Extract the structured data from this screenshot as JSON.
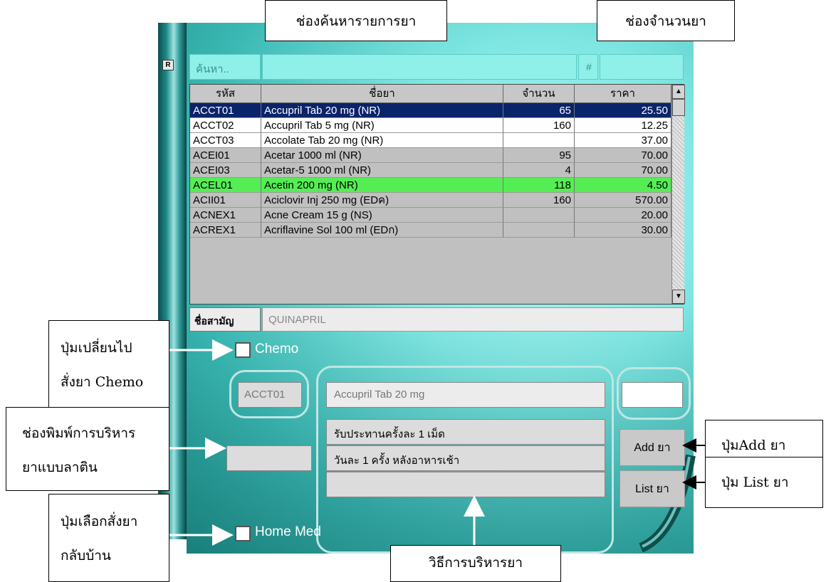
{
  "panel": {
    "corner_icon": "R",
    "search": {
      "label": "ค้นหา..",
      "value": ""
    },
    "qty": {
      "label": "#",
      "value": ""
    }
  },
  "grid": {
    "headers": [
      "รหัส",
      "ชื่อยา",
      "จำนวน",
      "ราคา"
    ],
    "rows": [
      {
        "code": "ACCT01",
        "name": "Accupril Tab 20 mg  (NR)",
        "qty": "65",
        "price": "25.50",
        "state": "selected"
      },
      {
        "code": "ACCT02",
        "name": "Accupril Tab 5 mg  (NR)",
        "qty": "160",
        "price": "12.25",
        "state": "white"
      },
      {
        "code": "ACCT03",
        "name": "Accolate Tab 20 mg  (NR)",
        "qty": "",
        "price": "37.00",
        "state": "white"
      },
      {
        "code": "ACEI01",
        "name": "Acetar 1000 ml  (NR)",
        "qty": "95",
        "price": "70.00",
        "state": "grey"
      },
      {
        "code": "ACEI03",
        "name": "Acetar-5 1000 ml  (NR)",
        "qty": "4",
        "price": "70.00",
        "state": "grey"
      },
      {
        "code": "ACEL01",
        "name": "Acetin 200 mg  (NR)",
        "qty": "118",
        "price": "4.50",
        "state": "green"
      },
      {
        "code": "ACII01",
        "name": "Aciclovir Inj 250 mg  (EDค)",
        "qty": "160",
        "price": "570.00",
        "state": "grey"
      },
      {
        "code": "ACNEX1",
        "name": "Acne Cream 15 g  (NS)",
        "qty": "",
        "price": "20.00",
        "state": "grey"
      },
      {
        "code": "ACREX1",
        "name": "Acriflavine Sol 100 ml  (EDก)",
        "qty": "",
        "price": "30.00",
        "state": "grey"
      }
    ]
  },
  "generic": {
    "label": "ชื่อสามัญ",
    "value": "QUINAPRIL"
  },
  "chemo": {
    "label": "Chemo"
  },
  "order": {
    "code": "ACCT01",
    "name": "Accupril Tab 20 mg",
    "qty": "",
    "latin": "",
    "instructions": [
      "รับประทานครั้งละ 1 เม็ด",
      "วันละ 1 ครั้ง หลังอาหารเช้า",
      ""
    ],
    "add_button": "Add ยา",
    "list_button": "List ยา"
  },
  "home_med": {
    "label": "Home Med"
  },
  "callouts": {
    "search_field": "ช่องค้นหารายการยา",
    "qty_field": "ช่องจำนวนยา",
    "chemo_toggle": [
      "ปุ่มเปลี่ยนไป",
      "สั่งยา Chemo"
    ],
    "latin_field": [
      "ช่องพิมพ์การบริหาร",
      "ยาแบบลาติน"
    ],
    "home_med_toggle": [
      "ปุ่มเลือกสั่งยา",
      "กลับบ้าน"
    ],
    "instructions": "วิธีการบริหารยา",
    "add_button": "ปุ่มAdd ยา",
    "list_button": "ปุ่ม List ยา"
  },
  "colors": {
    "selected": "#0a246a",
    "green": "#54ee54",
    "grey": "#c0c0c0",
    "white": "#ffffff",
    "panel": "#7fe6e2"
  }
}
